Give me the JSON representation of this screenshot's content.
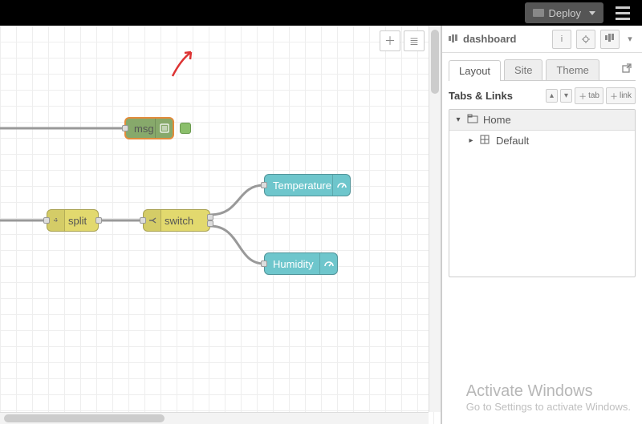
{
  "header": {
    "deploy_label": "Deploy"
  },
  "canvas": {
    "nodes": {
      "debug": "msg",
      "split": "split",
      "switch": "switch",
      "temperature": "Temperature",
      "humidity": "Humidity"
    }
  },
  "sidebar": {
    "title": "dashboard",
    "tabs": {
      "layout": "Layout",
      "site": "Site",
      "theme": "Theme"
    },
    "section_title": "Tabs & Links",
    "buttons": {
      "tab": "tab",
      "link": "link"
    },
    "tree": {
      "home": "Home",
      "default": "Default"
    }
  },
  "watermark": {
    "line1": "Activate Windows",
    "line2": "Go to Settings to activate Windows."
  }
}
